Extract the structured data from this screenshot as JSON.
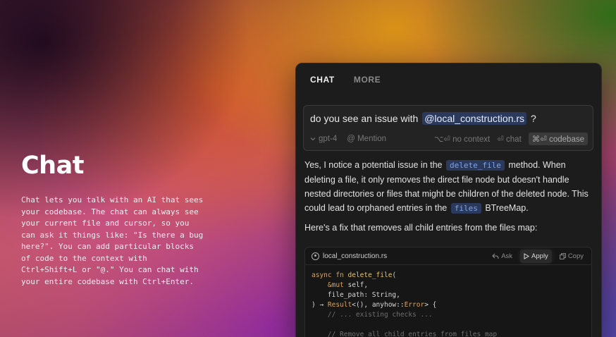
{
  "hero": {
    "title": "Chat",
    "description": "Chat lets you talk with an AI that sees your codebase. The chat can always see your current file and cursor, so you can ask it things like: \"Is there a bug here?\". You can add particular blocks of code to the context with Ctrl+Shift+L or \"@.\" You can chat with your entire codebase with Ctrl+Enter."
  },
  "panel": {
    "tabs": [
      {
        "label": "CHAT",
        "active": true
      },
      {
        "label": "MORE",
        "active": false
      }
    ],
    "input": {
      "prefix": "do you see an issue with",
      "mention": "@local_construction.rs",
      "suffix": " ?",
      "model": "gpt-4",
      "mention_hint": "@ Mention",
      "no_context": "⌥⏎ no context",
      "chat": "⏎ chat",
      "codebase": "⌘⏎ codebase"
    },
    "answer": {
      "part1": "Yes, I notice a potential issue in the",
      "chip1": "delete_file",
      "part2": " method. When deleting a file, it only removes the direct file node but doesn't handle nested directories or files that might be children of the deleted node. This could lead to orphaned entries in the",
      "chip2": "files",
      "part3": "BTreeMap.",
      "fix_intro": "Here's a fix that removes all child entries from the files map:"
    },
    "code": {
      "filename": "local_construction.rs",
      "ask": "Ask",
      "apply": "Apply",
      "copy": "Copy",
      "lines": {
        "l1_kw": "async fn",
        "l1_fn": "delete_file",
        "l1_rest": "(",
        "l2_kw": "&mut",
        "l2_rest": " self,",
        "l3": "file_path: String,",
        "l4_a": ") → ",
        "l4_ty": "Result",
        "l4_b": "<(), anyhow::",
        "l4_ty2": "Error",
        "l4_c": "> {",
        "l5": "// ... existing checks ...",
        "l6": "",
        "l7": "// Remove all child entries from files map"
      }
    }
  }
}
